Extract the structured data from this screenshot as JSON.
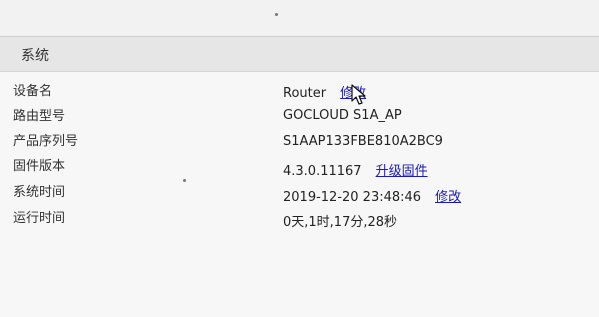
{
  "section": {
    "title": "系统"
  },
  "rows": [
    {
      "label": "设备名",
      "value": "Router",
      "link": "修改"
    },
    {
      "label": "路由型号",
      "value": "GOCLOUD S1A_AP"
    },
    {
      "label": "产品序列号",
      "value": "S1AAP133FBE810A2BC9"
    },
    {
      "label": "固件版本",
      "value": "4.3.0.11167",
      "link": "升级固件"
    },
    {
      "label": "系统时间",
      "value": "2019-12-20 23:48:46",
      "link": "修改"
    },
    {
      "label": "运行时间",
      "value": "0天,1时,17分,28秒"
    }
  ],
  "icons": {
    "pointer": "mouse-pointer-icon"
  },
  "colors": {
    "link": "#1a1ab6"
  }
}
